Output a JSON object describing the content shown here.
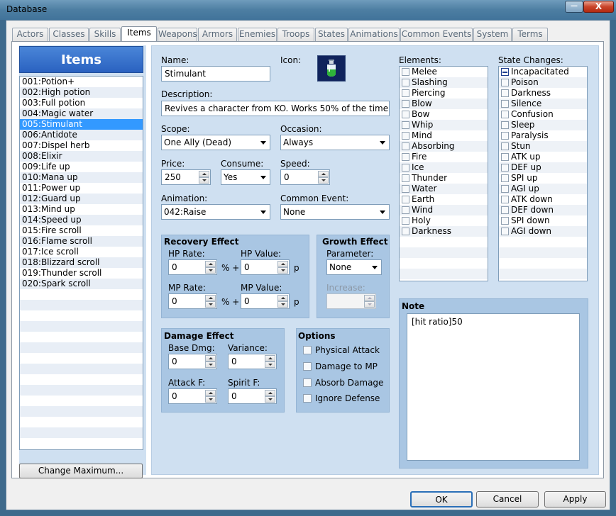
{
  "window": {
    "title": "Database",
    "minimize": "—",
    "close": "X"
  },
  "tabs": [
    "Actors",
    "Classes",
    "Skills",
    "Items",
    "Weapons",
    "Armors",
    "Enemies",
    "Troops",
    "States",
    "Animations",
    "Common Events",
    "System",
    "Terms"
  ],
  "active_tab": "Items",
  "left": {
    "header": "Items",
    "items": [
      "001:Potion+",
      "002:High potion",
      "003:Full potion",
      "004:Magic water",
      "005:Stimulant",
      "006:Antidote",
      "007:Dispel herb",
      "008:Elixir",
      "009:Life up",
      "010:Mana up",
      "011:Power up",
      "012:Guard up",
      "013:Mind up",
      "014:Speed up",
      "015:Fire scroll",
      "016:Flame scroll",
      "017:Ice scroll",
      "018:Blizzard scroll",
      "019:Thunder scroll",
      "020:Spark scroll"
    ],
    "selected_index": 4,
    "change_maximum": "Change Maximum..."
  },
  "form": {
    "name_label": "Name:",
    "name_value": "Stimulant",
    "icon_label": "Icon:",
    "description_label": "Description:",
    "description_value": "Revives a character from KO.  Works 50% of the time.",
    "scope_label": "Scope:",
    "scope_value": "One Ally (Dead)",
    "occasion_label": "Occasion:",
    "occasion_value": "Always",
    "price_label": "Price:",
    "price_value": "250",
    "consume_label": "Consume:",
    "consume_value": "Yes",
    "speed_label": "Speed:",
    "speed_value": "0",
    "animation_label": "Animation:",
    "animation_value": "042:Raise",
    "common_event_label": "Common Event:",
    "common_event_value": "None"
  },
  "recovery": {
    "title": "Recovery Effect",
    "hp_rate_label": "HP Rate:",
    "hp_rate": "0",
    "hp_value_label": "HP Value:",
    "hp_value": "0",
    "mp_rate_label": "MP Rate:",
    "mp_rate": "0",
    "mp_value_label": "MP Value:",
    "mp_value": "0",
    "pct_plus": "% +",
    "p": "p"
  },
  "growth": {
    "title": "Growth Effect",
    "parameter_label": "Parameter:",
    "parameter_value": "None",
    "increase_label": "Increase:"
  },
  "damage": {
    "title": "Damage Effect",
    "base_dmg_label": "Base Dmg:",
    "base_dmg": "0",
    "variance_label": "Variance:",
    "variance": "0",
    "attack_f_label": "Attack F:",
    "attack_f": "0",
    "spirit_f_label": "Spirit F:",
    "spirit_f": "0"
  },
  "options": {
    "title": "Options",
    "items": [
      "Physical Attack",
      "Damage to MP",
      "Absorb Damage",
      "Ignore Defense"
    ]
  },
  "elements": {
    "label": "Elements:",
    "items": [
      "Melee",
      "Slashing",
      "Piercing",
      "Blow",
      "Bow",
      "Whip",
      "Mind",
      "Absorbing",
      "Fire",
      "Ice",
      "Thunder",
      "Water",
      "Earth",
      "Wind",
      "Holy",
      "Darkness"
    ]
  },
  "states": {
    "label": "State Changes:",
    "items": [
      "Incapacitated",
      "Poison",
      "Darkness",
      "Silence",
      "Confusion",
      "Sleep",
      "Paralysis",
      "Stun",
      "ATK up",
      "DEF up",
      "SPI up",
      "AGI up",
      "ATK down",
      "DEF down",
      "SPI down",
      "AGI down"
    ],
    "marked": [
      "Incapacitated"
    ]
  },
  "note": {
    "title": "Note",
    "text": "[hit ratio]50"
  },
  "buttons": {
    "ok": "OK",
    "cancel": "Cancel",
    "apply": "Apply"
  }
}
